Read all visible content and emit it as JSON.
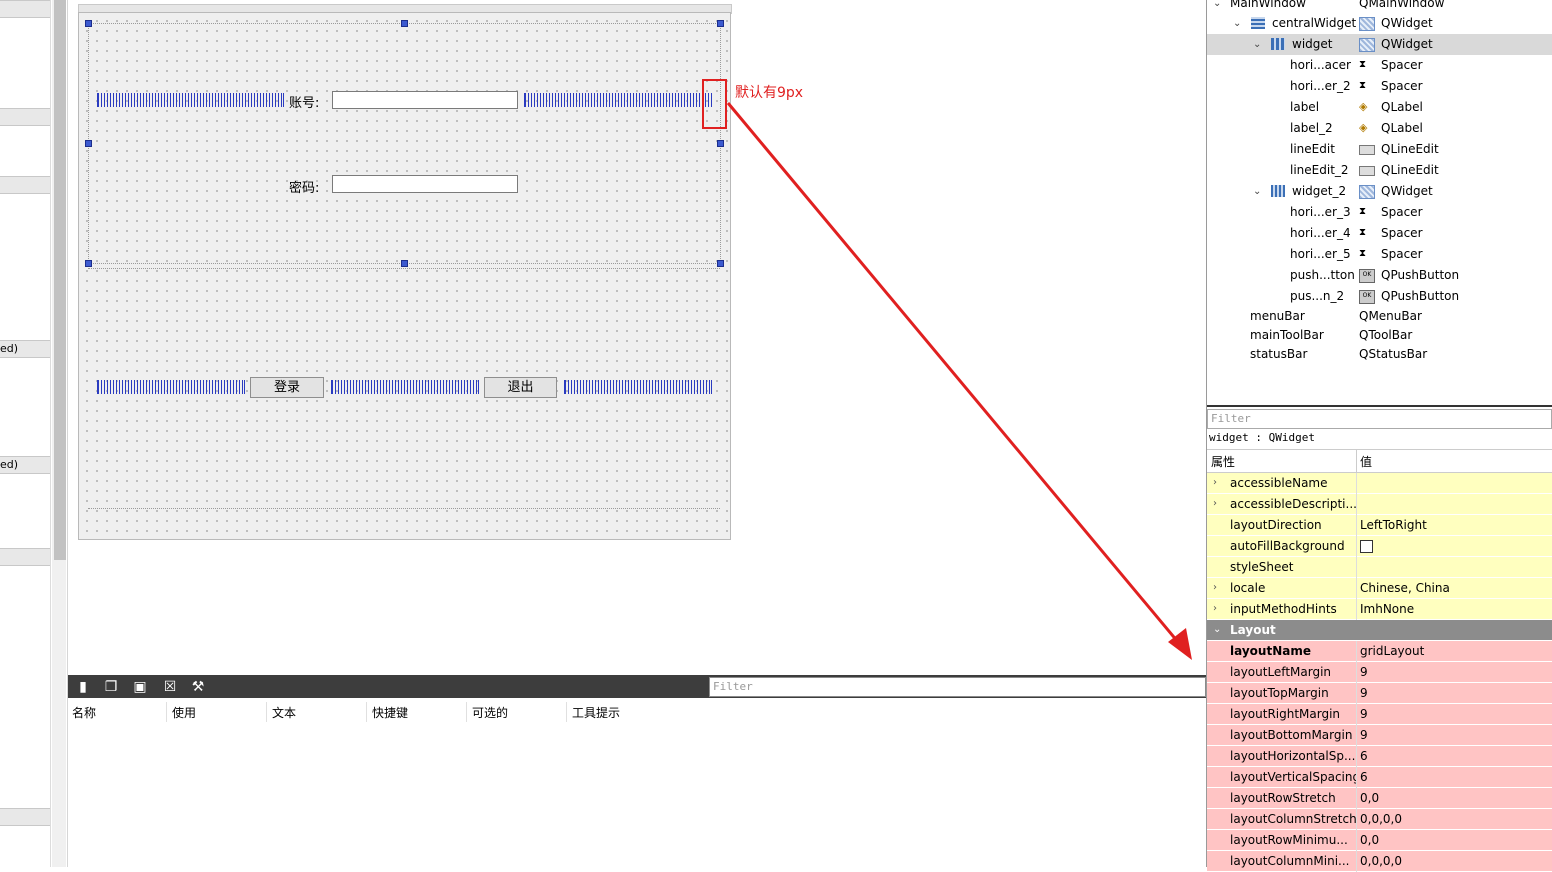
{
  "left_panel": {
    "truncated_labels": [
      "ed)",
      "ed)"
    ]
  },
  "form": {
    "account_label": "账号:",
    "password_label": "密码:",
    "login_button": "登录",
    "exit_button": "退出"
  },
  "annotation": {
    "text": "默认有9px",
    "color": "#e02020"
  },
  "action_editor": {
    "filter_placeholder": "Filter",
    "columns": [
      "名称",
      "使用",
      "文本",
      "快捷键",
      "可选的",
      "工具提示"
    ],
    "toolbar_icons": [
      "new-action-icon",
      "copy-action-icon",
      "paste-action-icon",
      "delete-action-icon",
      "configure-icon"
    ]
  },
  "object_inspector": {
    "rows": [
      {
        "name": "MainWindow",
        "class": "QMainWindow",
        "icon": "none"
      },
      {
        "name": "centralWidget",
        "class": "QWidget",
        "icon": "form-layout-icon"
      },
      {
        "name": "widget",
        "class": "QWidget",
        "icon": "grid-layout-icon"
      },
      {
        "name": "hori...acer",
        "class": "Spacer",
        "icon": "spacer-icon"
      },
      {
        "name": "hori...er_2",
        "class": "Spacer",
        "icon": "spacer-icon"
      },
      {
        "name": "label",
        "class": "QLabel",
        "icon": "label-icon"
      },
      {
        "name": "label_2",
        "class": "QLabel",
        "icon": "label-icon"
      },
      {
        "name": "lineEdit",
        "class": "QLineEdit",
        "icon": "lineedit-icon"
      },
      {
        "name": "lineEdit_2",
        "class": "QLineEdit",
        "icon": "lineedit-icon"
      },
      {
        "name": "widget_2",
        "class": "QWidget",
        "icon": "hbox-layout-icon"
      },
      {
        "name": "hori...er_3",
        "class": "Spacer",
        "icon": "spacer-icon"
      },
      {
        "name": "hori...er_4",
        "class": "Spacer",
        "icon": "spacer-icon"
      },
      {
        "name": "hori...er_5",
        "class": "Spacer",
        "icon": "spacer-icon"
      },
      {
        "name": "push...tton",
        "class": "QPushButton",
        "icon": "pushbutton-icon"
      },
      {
        "name": "pus...n_2",
        "class": "QPushButton",
        "icon": "pushbutton-icon"
      },
      {
        "name": "menuBar",
        "class": "QMenuBar",
        "icon": "none"
      },
      {
        "name": "mainToolBar",
        "class": "QToolBar",
        "icon": "none"
      },
      {
        "name": "statusBar",
        "class": "QStatusBar",
        "icon": "none"
      }
    ]
  },
  "property_editor": {
    "filter_placeholder": "Filter",
    "caption": "widget : QWidget",
    "header_name": "属性",
    "header_value": "值",
    "rows": [
      {
        "name": "accessibleName",
        "value": "",
        "style": "yellow",
        "toggle": "›"
      },
      {
        "name": "accessibleDescripti...",
        "value": "",
        "style": "yellow",
        "toggle": "›"
      },
      {
        "name": "layoutDirection",
        "value": "LeftToRight",
        "style": "yellow",
        "toggle": ""
      },
      {
        "name": "autoFillBackground",
        "value": "",
        "style": "yellow",
        "toggle": "",
        "checkbox": true
      },
      {
        "name": "styleSheet",
        "value": "",
        "style": "yellow",
        "toggle": ""
      },
      {
        "name": "locale",
        "value": "Chinese, China",
        "style": "yellow",
        "toggle": "›"
      },
      {
        "name": "inputMethodHints",
        "value": "ImhNone",
        "style": "yellow",
        "toggle": "›"
      },
      {
        "name": "Layout",
        "value": "",
        "style": "group",
        "toggle": "⌄"
      },
      {
        "name": "layoutName",
        "value": "gridLayout",
        "style": "red-bold",
        "toggle": ""
      },
      {
        "name": "layoutLeftMargin",
        "value": "9",
        "style": "red",
        "toggle": ""
      },
      {
        "name": "layoutTopMargin",
        "value": "9",
        "style": "red",
        "toggle": ""
      },
      {
        "name": "layoutRightMargin",
        "value": "9",
        "style": "red",
        "toggle": ""
      },
      {
        "name": "layoutBottomMargin",
        "value": "9",
        "style": "red",
        "toggle": ""
      },
      {
        "name": "layoutHorizontalSp...",
        "value": "6",
        "style": "red",
        "toggle": ""
      },
      {
        "name": "layoutVerticalSpacing",
        "value": "6",
        "style": "red",
        "toggle": ""
      },
      {
        "name": "layoutRowStretch",
        "value": "0,0",
        "style": "red",
        "toggle": ""
      },
      {
        "name": "layoutColumnStretch",
        "value": "0,0,0,0",
        "style": "red",
        "toggle": ""
      },
      {
        "name": "layoutRowMinimu...",
        "value": "0,0",
        "style": "red",
        "toggle": ""
      },
      {
        "name": "layoutColumnMini...",
        "value": "0,0,0,0",
        "style": "red",
        "toggle": ""
      }
    ]
  }
}
